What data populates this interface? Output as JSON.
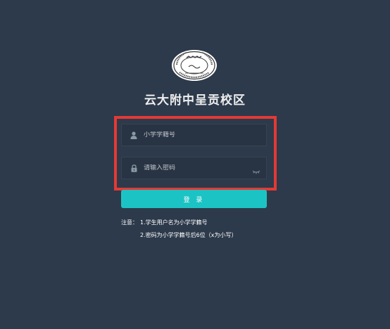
{
  "header": {
    "title": "云大附中呈贡校区"
  },
  "form": {
    "username_placeholder": "小学学籍号",
    "password_placeholder": "请输入密码",
    "username_value": "",
    "password_value": "",
    "login_label": "登 录"
  },
  "notes": {
    "prefix": "注意：",
    "line1": "1.学生用户名为小学学籍号",
    "line2": "2.密码为小学学籍号后6位（x为小写）"
  },
  "colors": {
    "background": "#2d3a4b",
    "field_bg": "#283443",
    "accent": "#1cc3c4",
    "highlight": "#e53935"
  },
  "icons": {
    "logo": "school-seal-logo",
    "username": "user-icon",
    "password": "lock-icon",
    "visibility": "eye-closed-icon"
  }
}
